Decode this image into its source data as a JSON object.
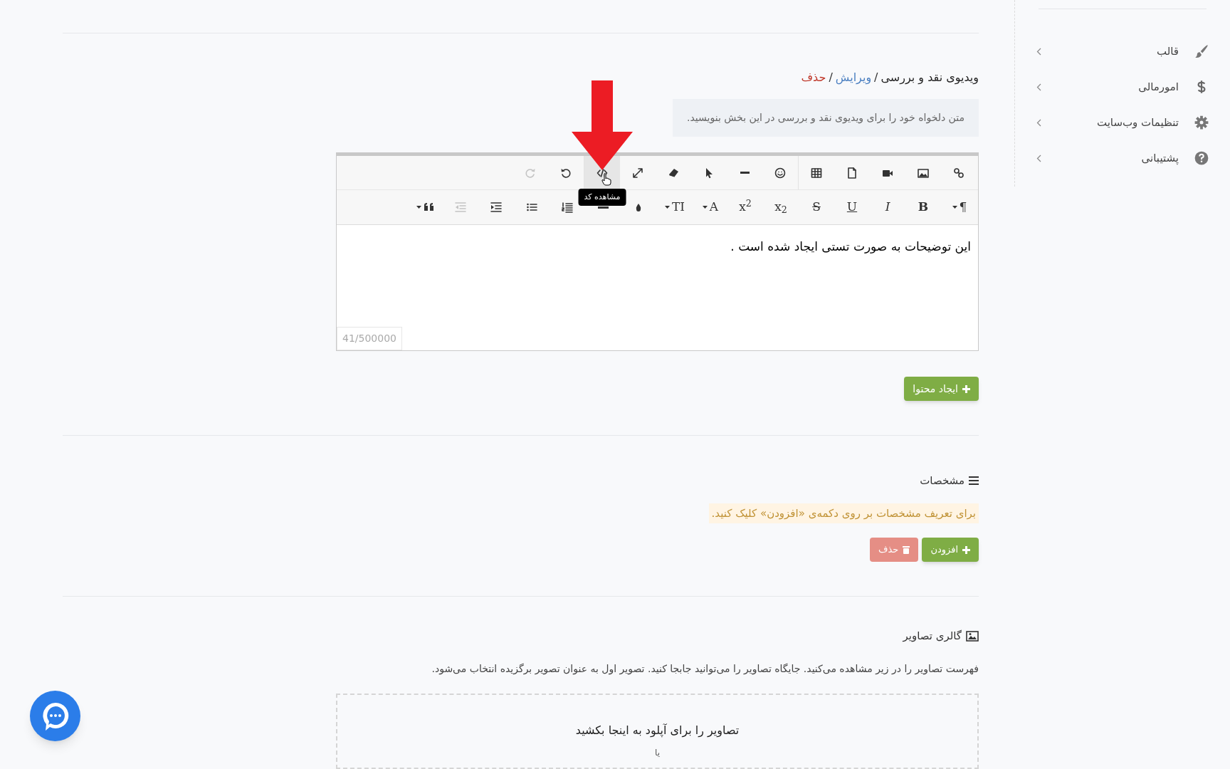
{
  "sidebar": {
    "items": [
      {
        "label": "قالب"
      },
      {
        "label": "امورمالی"
      },
      {
        "label": "تنظیمات وب‌سایت"
      },
      {
        "label": "پشتیبانی"
      }
    ]
  },
  "breadcrumb": [
    {
      "label": "ویدیوی نقد و بررسی",
      "kind": "title"
    },
    {
      "label": "/",
      "kind": "separator"
    },
    {
      "label": "ویرایش",
      "kind": "link"
    },
    {
      "label": "/",
      "kind": "separator"
    },
    {
      "label": "حذف",
      "kind": "danger"
    }
  ],
  "hint": "متن دلخواه خود را برای ویدیوی نقد و بررسی در این بخش بنویسید.",
  "editor": {
    "toolbar": [
      [
        {
          "kind": "icon"
        },
        {
          "kind": "icon"
        },
        {
          "kind": "icon"
        },
        {
          "kind": "icon"
        },
        {
          "kind": "icon"
        },
        {
          "kind": "separator"
        },
        {
          "kind": "icon"
        },
        {
          "kind": "icon"
        },
        {
          "kind": "icon"
        },
        {
          "kind": "icon"
        },
        {
          "kind": "icon"
        },
        {
          "kind": "icon",
          "active": true
        },
        {
          "kind": "separator"
        },
        {
          "kind": "icon"
        },
        {
          "kind": "icon",
          "disabled": true
        }
      ],
      [
        {
          "kind": "text",
          "label": "¶",
          "caret": true
        },
        {
          "kind": "bold",
          "label": "B"
        },
        {
          "kind": "italic",
          "label": "I"
        },
        {
          "kind": "underline",
          "label": "U"
        },
        {
          "kind": "strike",
          "label": "S"
        },
        {
          "kind": "text",
          "label": "x$_{2}$"
        },
        {
          "kind": "text",
          "label": "x$^{2}$"
        },
        {
          "kind": "text",
          "label": "A",
          "caret": true
        },
        {
          "kind": "text",
          "label": "TI",
          "caret": true
        },
        {
          "kind": "icon"
        },
        {
          "kind": "icon"
        },
        {
          "kind": "icon"
        },
        {
          "kind": "icon"
        },
        {
          "kind": "icon"
        },
        {
          "kind": "icon",
          "disabled": true
        },
        {
          "kind": "icon",
          "caret": true
        }
      ]
    ],
    "tooltip": "مشاهده کد",
    "content": "این توضیحات به صورت تستی ایجاد شده است .",
    "counter": "41/500000"
  },
  "create_button": "ایجاد محتوا",
  "specs": {
    "title": "مشخصات",
    "notice": "برای تعریف مشخصات بر روی دکمه‌ی «افزودن» کلیک کنید.",
    "buttons": [
      {
        "label": "افزودن",
        "kind": "add",
        "disabled": false
      },
      {
        "label": "حذف",
        "kind": "delete",
        "disabled": true
      }
    ]
  },
  "gallery": {
    "title": "گالری تصاویر",
    "description": "فهرست تصاویر را در زیر مشاهده می‌کنید. جایگاه تصاویر را می‌توانید جابجا کنید. تصویر اول به عنوان تصویر برگزیده انتخاب می‌شود.",
    "dropzone_title": "تصاویر را برای آپلود به اینجا بکشید",
    "dropzone_or": "یا"
  }
}
